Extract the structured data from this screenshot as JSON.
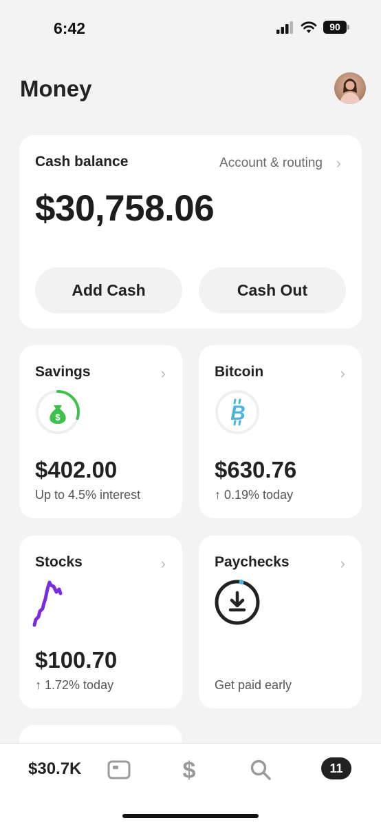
{
  "status_bar": {
    "time": "6:42",
    "battery": "90"
  },
  "header": {
    "title": "Money"
  },
  "balance_card": {
    "title": "Cash balance",
    "account_link": "Account & routing",
    "amount": "$30,758.06",
    "add_cash_label": "Add Cash",
    "cash_out_label": "Cash Out"
  },
  "savings": {
    "title": "Savings",
    "amount": "$402.00",
    "subtitle": "Up to 4.5% interest",
    "icon": "money-bag-icon",
    "progress": 0.3
  },
  "bitcoin": {
    "title": "Bitcoin",
    "amount": "$630.76",
    "subtitle": "↑ 0.19% today",
    "icon": "bitcoin-icon"
  },
  "stocks": {
    "title": "Stocks",
    "amount": "$100.70",
    "subtitle": "↑ 1.72% today",
    "icon": "stock-sparkline"
  },
  "paychecks": {
    "title": "Paychecks",
    "subtitle": "Get paid early",
    "icon": "download-icon"
  },
  "bottom_nav": {
    "balance": "$30.7K",
    "items": [
      {
        "icon": "card-icon"
      },
      {
        "icon": "dollar-icon"
      },
      {
        "icon": "search-icon"
      }
    ],
    "activity_badge": "11"
  },
  "colors": {
    "savings_green": "#3cc24a",
    "bitcoin_blue": "#4ab4e0",
    "stocks_purple": "#7a2be0",
    "paychecks_accent": "#4ab4e0"
  }
}
